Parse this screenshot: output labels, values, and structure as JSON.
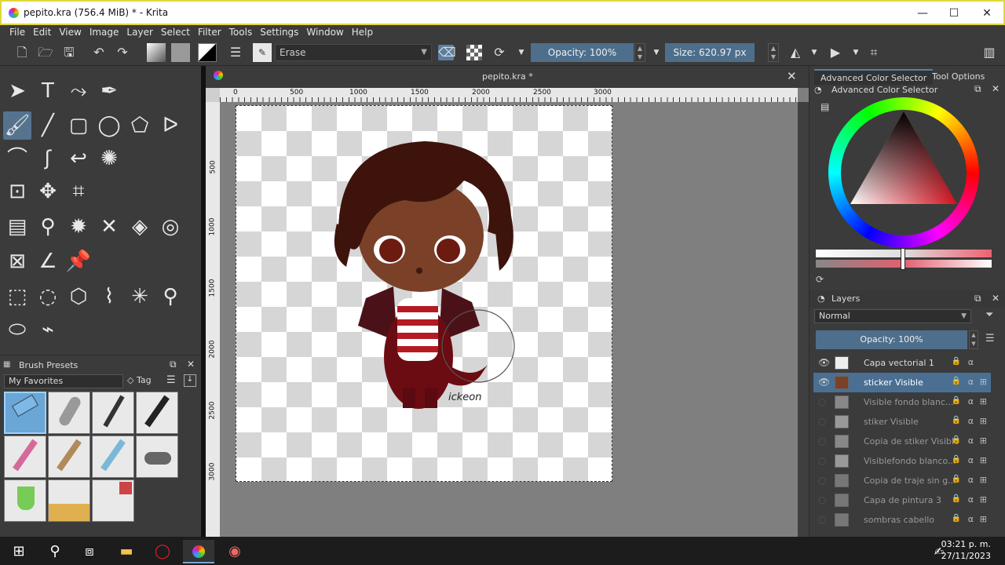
{
  "window": {
    "title": "pepito.kra (756.4 MiB) * - Krita",
    "minimize": "—",
    "maximize": "☐",
    "close": "✕"
  },
  "menu": [
    "File",
    "Edit",
    "View",
    "Image",
    "Layer",
    "Select",
    "Filter",
    "Tools",
    "Settings",
    "Window",
    "Help"
  ],
  "toolbar": {
    "blend_mode": "Erase",
    "opacity": "Opacity: 100%",
    "size": "Size: 620.97 px"
  },
  "canvas": {
    "tab_title": "pepito.kra *",
    "close": "✕",
    "ruler_top": [
      "0",
      "500",
      "1000",
      "1500",
      "2000",
      "2500",
      "3000"
    ],
    "ruler_left": [
      "500",
      "1000",
      "1500",
      "2000",
      "2500",
      "3000"
    ],
    "signature": "ickeon"
  },
  "brush_presets": {
    "title": "Brush Presets",
    "filter": "My Favorites",
    "tag": "Tag"
  },
  "right_panel": {
    "tabs": [
      "Advanced Color Selector",
      "Tool Options"
    ],
    "color_selector_title": "Advanced Color Selector",
    "layers_title": "Layers",
    "blend": "Normal",
    "opacity": "Opacity:  100%",
    "layers": [
      {
        "name": "Capa vectorial 1",
        "visible": true,
        "selected": false
      },
      {
        "name": "sticker Visible",
        "visible": true,
        "selected": true
      },
      {
        "name": "Visible fondo blanc...",
        "visible": false,
        "selected": false
      },
      {
        "name": "stiker Visible",
        "visible": false,
        "selected": false
      },
      {
        "name": "Copia de stiker Visible",
        "visible": false,
        "selected": false
      },
      {
        "name": "Visiblefondo blanco...",
        "visible": false,
        "selected": false
      },
      {
        "name": "Copia de traje sin g...",
        "visible": false,
        "selected": false
      },
      {
        "name": "Capa de pintura 3",
        "visible": false,
        "selected": false
      },
      {
        "name": "sombras cabello",
        "visible": false,
        "selected": false
      }
    ]
  },
  "taskbar": {
    "time": "03:21 p. m.",
    "date": "27/11/2023"
  },
  "colors": {
    "accent": "#4e6f8c",
    "selected_layer": "#4a6f93",
    "panel_bg": "#3b3b3b",
    "canvas_bg": "#7f7f7f"
  }
}
